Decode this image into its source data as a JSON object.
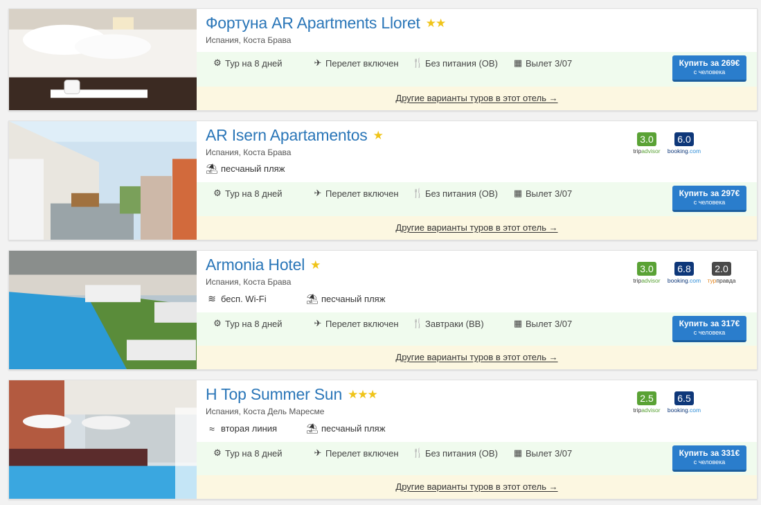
{
  "hotels": [
    {
      "name": "Фортуна AR Apartments Lloret",
      "stars": "★★",
      "location": "Испания, Коста Брава",
      "features": [],
      "ratings": [],
      "tour": {
        "duration": "Тур на 8 дней",
        "flight": "Перелет включен",
        "meals": "Без питания (OB)",
        "departure": "Вылет 3/07"
      },
      "buy": {
        "label": "Купить за 269€",
        "sub": "с человека"
      },
      "more_link": "Другие варианты туров в этот отель →"
    },
    {
      "name": "AR Isern Apartamentos",
      "stars": "★",
      "location": "Испания, Коста Брава",
      "features": [
        {
          "icon": "beach-umbrella-icon",
          "text": "песчаный пляж"
        }
      ],
      "ratings": [
        {
          "score": "3.0",
          "source_a": "trip",
          "source_b": "advisor",
          "kind": "ta"
        },
        {
          "score": "6.0",
          "source_a": "booking",
          "source_b": ".com",
          "kind": "bk"
        }
      ],
      "tour": {
        "duration": "Тур на 8 дней",
        "flight": "Перелет включен",
        "meals": "Без питания (OB)",
        "departure": "Вылет 3/07"
      },
      "buy": {
        "label": "Купить за 297€",
        "sub": "с человека"
      },
      "more_link": "Другие варианты туров в этот отель →"
    },
    {
      "name": "Armonia Hotel",
      "stars": "★",
      "location": "Испания, Коста Брава",
      "features": [
        {
          "icon": "wifi-icon",
          "text": "бесп. Wi-Fi"
        },
        {
          "icon": "beach-umbrella-icon",
          "text": "песчаный пляж"
        }
      ],
      "ratings": [
        {
          "score": "3.0",
          "source_a": "trip",
          "source_b": "advisor",
          "kind": "ta"
        },
        {
          "score": "6.8",
          "source_a": "booking",
          "source_b": ".com",
          "kind": "bk"
        },
        {
          "score": "2.0",
          "source_a": "тур",
          "source_b": "правда",
          "kind": "tp"
        }
      ],
      "tour": {
        "duration": "Тур на 8 дней",
        "flight": "Перелет включен",
        "meals": "Завтраки (BB)",
        "departure": "Вылет 3/07"
      },
      "buy": {
        "label": "Купить за 317€",
        "sub": "с человека"
      },
      "more_link": "Другие варианты туров в этот отель →"
    },
    {
      "name": "H Top Summer Sun",
      "stars": "★★★",
      "location": "Испания, Коста Дель Маресме",
      "features": [
        {
          "icon": "waves-icon",
          "text": "вторая линия"
        },
        {
          "icon": "beach-umbrella-icon",
          "text": "песчаный пляж"
        }
      ],
      "ratings": [
        {
          "score": "2.5",
          "source_a": "trip",
          "source_b": "advisor",
          "kind": "ta"
        },
        {
          "score": "6.5",
          "source_a": "booking",
          "source_b": ".com",
          "kind": "bk"
        }
      ],
      "tour": {
        "duration": "Тур на 8 дней",
        "flight": "Перелет включен",
        "meals": "Без питания (OB)",
        "departure": "Вылет 3/07"
      },
      "buy": {
        "label": "Купить за 331€",
        "sub": "с человека"
      },
      "more_link": "Другие варианты туров в этот отель →"
    }
  ],
  "icons": {
    "duration": "gear-icon",
    "flight": "plane-icon",
    "meals": "fork-knife-icon",
    "departure": "calendar-icon"
  },
  "colors": {
    "title": "#2a76b8",
    "button": "#2a7dcc",
    "tour_band": "#f0fbee",
    "more_band": "#fcf7e1",
    "star": "#f0c419"
  }
}
